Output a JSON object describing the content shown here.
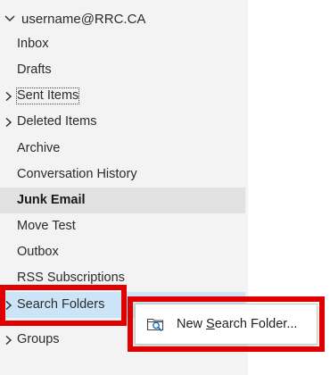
{
  "account": {
    "name": "username@RRC.CA"
  },
  "folders": [
    {
      "label": "Inbox"
    },
    {
      "label": "Drafts"
    },
    {
      "label": "Sent Items"
    },
    {
      "label": "Deleted Items"
    },
    {
      "label": "Archive"
    },
    {
      "label": "Conversation History"
    },
    {
      "label": "Junk Email"
    },
    {
      "label": "Move Test"
    },
    {
      "label": "Outbox"
    },
    {
      "label": "RSS Subscriptions"
    },
    {
      "label": "Search Folders"
    },
    {
      "label": "Groups"
    }
  ],
  "context_menu": {
    "new_search_folder": {
      "before": "New ",
      "mnemonic": "S",
      "after": "earch Folder..."
    }
  },
  "colors": {
    "highlight_red": "#e00000",
    "selected_bg": "#e1e1e1",
    "hover_bg": "#cce4f7"
  },
  "icons": {
    "expand": "chevron-right-icon",
    "collapse": "chevron-down-icon",
    "search_folder": "search-folder-icon"
  }
}
